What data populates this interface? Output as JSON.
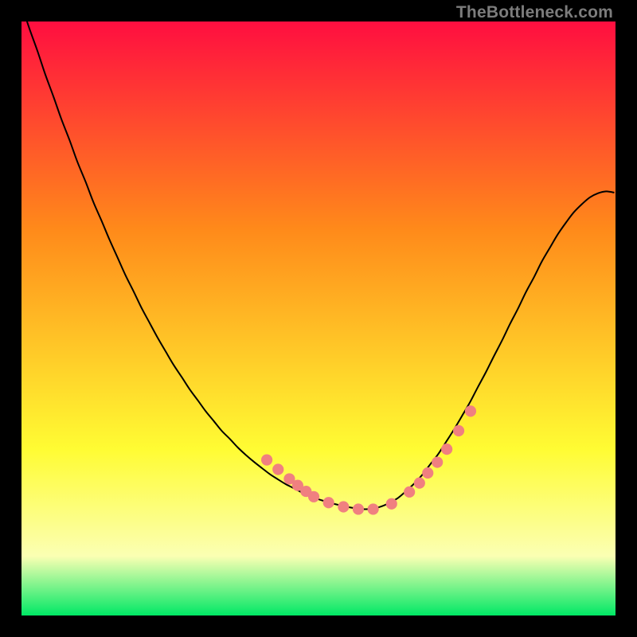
{
  "watermark": "TheBottleneck.com",
  "colors": {
    "gradient_top": "#ff0e40",
    "gradient_mid1": "#ff8a1a",
    "gradient_mid2": "#fffc33",
    "gradient_light": "#fbffb3",
    "gradient_bottom": "#00e865",
    "curve": "#000000",
    "dot": "#f08080"
  },
  "chart_data": {
    "type": "line",
    "title": "",
    "xlabel": "",
    "ylabel": "",
    "xlim": [
      0,
      1
    ],
    "ylim": [
      0,
      1
    ],
    "grid": false,
    "series": [
      {
        "name": "curve",
        "x": [
          0.0,
          0.013,
          0.027,
          0.04,
          0.054,
          0.067,
          0.081,
          0.094,
          0.108,
          0.121,
          0.135,
          0.148,
          0.162,
          0.175,
          0.189,
          0.202,
          0.216,
          0.229,
          0.243,
          0.256,
          0.27,
          0.283,
          0.297,
          0.31,
          0.324,
          0.337,
          0.351,
          0.364,
          0.378,
          0.391,
          0.405,
          0.418,
          0.432,
          0.445,
          0.459,
          0.472,
          0.485,
          0.499,
          0.512,
          0.526,
          0.539,
          0.553,
          0.566,
          0.58,
          0.593,
          0.607,
          0.62,
          0.634,
          0.647,
          0.66,
          0.674,
          0.687,
          0.701,
          0.714,
          0.728,
          0.741,
          0.755,
          0.768,
          0.782,
          0.795,
          0.809,
          0.822,
          0.836,
          0.849,
          0.863,
          0.876,
          0.89,
          0.903,
          0.917,
          0.93,
          0.944,
          0.957,
          0.971,
          0.984,
          0.998
        ],
        "y": [
          1.029,
          0.989,
          0.95,
          0.911,
          0.873,
          0.836,
          0.8,
          0.764,
          0.73,
          0.696,
          0.664,
          0.633,
          0.602,
          0.573,
          0.545,
          0.518,
          0.492,
          0.468,
          0.444,
          0.422,
          0.401,
          0.381,
          0.362,
          0.344,
          0.327,
          0.311,
          0.297,
          0.283,
          0.27,
          0.259,
          0.248,
          0.238,
          0.229,
          0.221,
          0.214,
          0.207,
          0.201,
          0.196,
          0.192,
          0.188,
          0.185,
          0.182,
          0.18,
          0.179,
          0.18,
          0.184,
          0.19,
          0.198,
          0.209,
          0.221,
          0.236,
          0.253,
          0.271,
          0.291,
          0.313,
          0.335,
          0.359,
          0.384,
          0.41,
          0.436,
          0.463,
          0.49,
          0.517,
          0.544,
          0.57,
          0.596,
          0.62,
          0.642,
          0.662,
          0.679,
          0.693,
          0.704,
          0.711,
          0.714,
          0.712
        ]
      }
    ],
    "dots": {
      "name": "markers",
      "x": [
        0.413,
        0.432,
        0.451,
        0.465,
        0.479,
        0.492,
        0.517,
        0.542,
        0.567,
        0.592,
        0.623,
        0.653,
        0.67,
        0.684,
        0.7,
        0.716,
        0.736,
        0.756
      ],
      "y": [
        0.262,
        0.246,
        0.23,
        0.219,
        0.209,
        0.2,
        0.19,
        0.183,
        0.179,
        0.179,
        0.188,
        0.208,
        0.223,
        0.24,
        0.258,
        0.28,
        0.311,
        0.344
      ],
      "radius_x": 0.0095
    }
  }
}
